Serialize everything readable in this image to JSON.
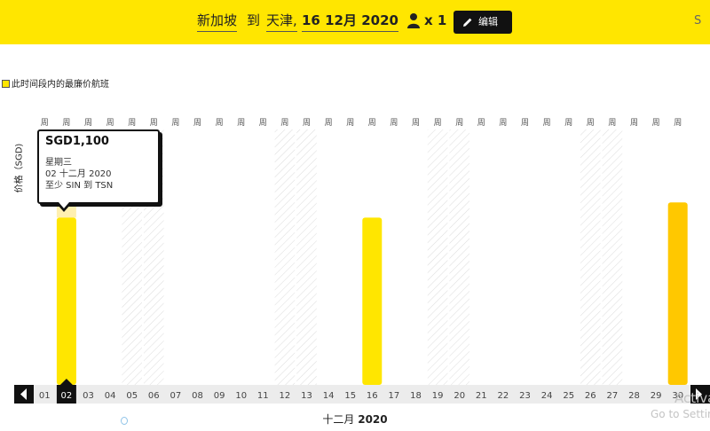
{
  "header": {
    "origin": "新加坡",
    "to_word": "到",
    "destination": "天津,",
    "date": "16 12月 2020",
    "pax": "x 1",
    "edit_label": "编辑",
    "right_letter": "S"
  },
  "legend": {
    "label": "此时间段内的最廉价航班"
  },
  "colors": {
    "brand_yellow": "#ffe600",
    "highlight_bar": "#ffc800",
    "hover_bar": "#fff0b0",
    "selected_date_bg": "#111111",
    "nav_bg": "#111111"
  },
  "icons": {
    "pax": "person-icon",
    "edit": "pencil-icon",
    "prev": "arrow-left-icon",
    "next": "arrow-right-icon"
  },
  "tooltip": {
    "price": "SGD1,100",
    "weekday": "星期三",
    "date": "02 十二月 2020",
    "route": "至少 SIN 到 TSN"
  },
  "chart_data": {
    "type": "bar",
    "ylabel": "价格（SGD)",
    "xlabel_month": "十二月",
    "xlabel_year": "2020",
    "day_label": "周",
    "categories": [
      "01",
      "02",
      "03",
      "04",
      "05",
      "06",
      "07",
      "08",
      "09",
      "10",
      "11",
      "12",
      "13",
      "14",
      "15",
      "16",
      "17",
      "18",
      "19",
      "20",
      "21",
      "22",
      "23",
      "24",
      "25",
      "26",
      "27",
      "28",
      "29",
      "30"
    ],
    "values": [
      null,
      1100,
      null,
      null,
      null,
      null,
      null,
      null,
      null,
      null,
      null,
      null,
      null,
      null,
      null,
      1100,
      null,
      null,
      null,
      null,
      null,
      null,
      null,
      null,
      null,
      null,
      null,
      null,
      null,
      1200
    ],
    "selected": "02",
    "hover": "02",
    "highlight": "30",
    "unavailable": [
      "05",
      "06",
      "12",
      "13",
      "19",
      "20",
      "26",
      "27"
    ],
    "ylim": [
      0,
      1680
    ],
    "grid": false,
    "legend_position": "top-left"
  },
  "watermark": {
    "line1": "Activate",
    "line2": "Go to Settin"
  }
}
